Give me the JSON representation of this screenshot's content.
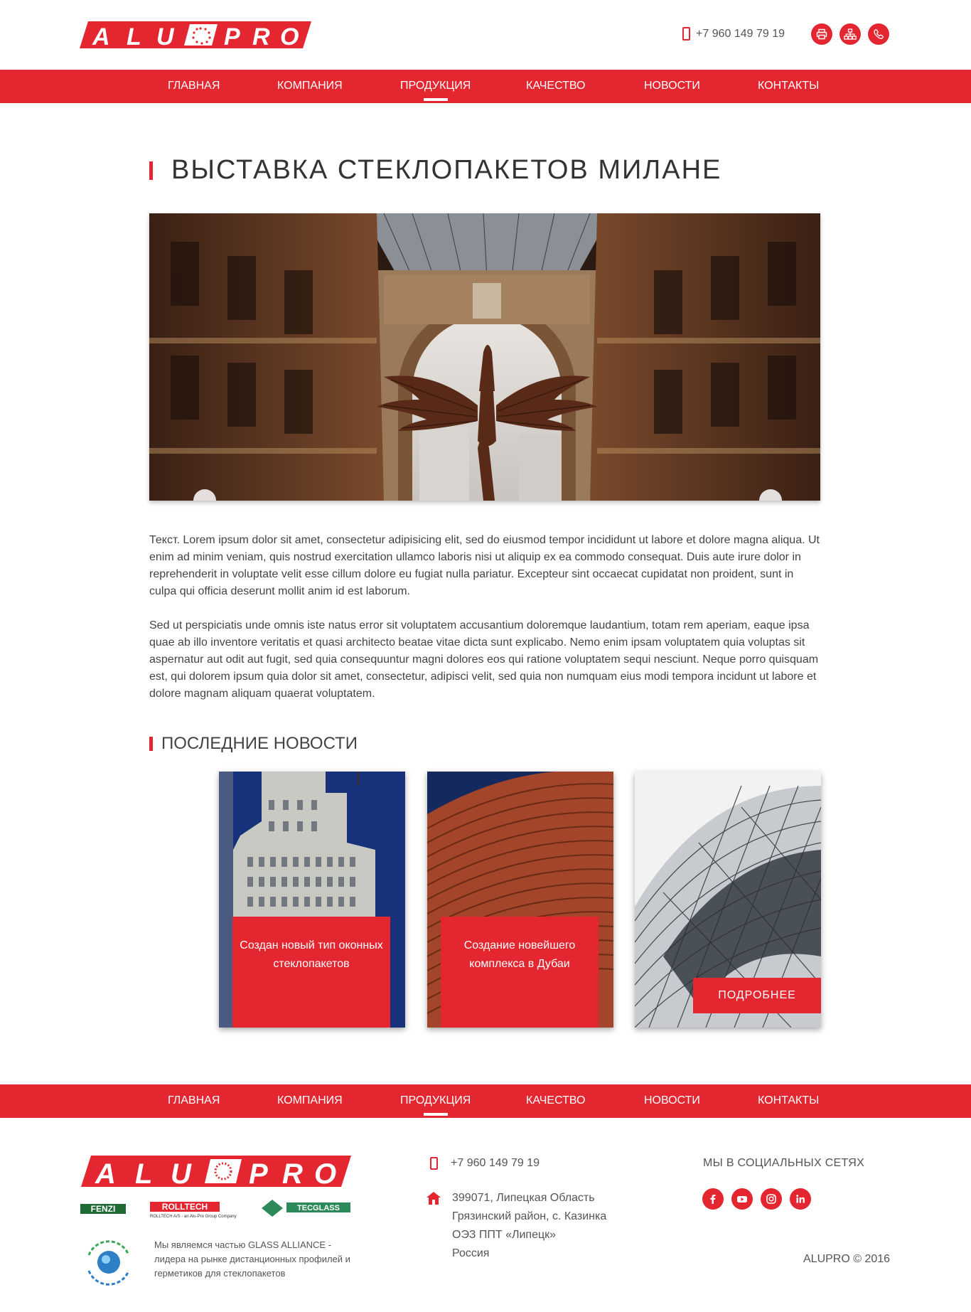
{
  "brand": {
    "logo_text": "ALUPRO",
    "primary_color": "#e32630"
  },
  "header": {
    "phone": "+7 960 149 79 19",
    "icons": [
      "print-icon",
      "sitemap-icon",
      "phone-call-icon"
    ]
  },
  "nav": {
    "items": [
      {
        "label": "ГЛАВНАЯ"
      },
      {
        "label": "КОМПАНИЯ"
      },
      {
        "label": "ПРОДУКЦИЯ",
        "active": true
      },
      {
        "label": "КАЧЕСТВО"
      },
      {
        "label": "НОВОСТИ"
      },
      {
        "label": "КОНТАКТЫ"
      }
    ]
  },
  "page": {
    "title": "ВЫСТАВКА СТЕКЛОПАКЕТОВ МИЛАНЕ",
    "paragraphs": [
      "Текст. Lorem ipsum dolor sit amet, consectetur adipisicing elit, sed do eiusmod tempor incididunt ut labore et dolore magna aliqua. Ut enim ad minim veniam, quis nostrud exercitation ullamco laboris nisi ut aliquip ex ea commodo consequat. Duis aute irure dolor in reprehenderit in voluptate velit esse cillum dolore eu fugiat nulla pariatur. Excepteur sint occaecat cupidatat non proident, sunt in culpa qui officia deserunt mollit anim id est laborum.",
      "Sed ut perspiciatis unde omnis iste natus error sit voluptatem accusantium doloremque laudantium, totam rem aperiam, eaque ipsa quae ab illo inventore veritatis et quasi architecto beatae vitae dicta sunt explicabo. Nemo enim ipsam voluptatem quia voluptas sit aspernatur aut odit aut fugit, sed quia consequuntur magni dolores eos qui ratione voluptatem sequi nesciunt. Neque porro quisquam est, qui dolorem ipsum quia dolor sit amet, consectetur, adipisci velit, sed quia non numquam eius modi tempora incidunt ut labore et dolore magnam aliquam quaerat voluptatem."
    ]
  },
  "news": {
    "heading": "ПОСЛЕДНИЕ НОВОСТИ",
    "cards": [
      {
        "caption": "Создан новый тип оконных стеклопакетов"
      },
      {
        "caption": "Создание новейшего комплекса в Дубаи"
      },
      {
        "button": "ПОДРОБНЕЕ"
      }
    ]
  },
  "footer": {
    "partners": [
      "FENZI",
      "ROLLTECH",
      "TECGLASS"
    ],
    "alliance_text": "Мы являемся частью GLASS ALLIANCE - лидера на рынке дистанционных профилей и герметиков для стеклопакетов",
    "phone": "+7 960 149 79 19",
    "address_lines": [
      "399071, Липецкая Область",
      "Грязинский район, с. Казинка",
      "ОЭЗ ППТ «Липецк»",
      "Россия"
    ],
    "social_title": "МЫ В СОЦИАЛЬНЫХ СЕТЯХ",
    "social_icons": [
      "facebook-icon",
      "youtube-icon",
      "instagram-icon",
      "linkedin-icon"
    ],
    "copyright": "ALUPRO © 2016"
  }
}
